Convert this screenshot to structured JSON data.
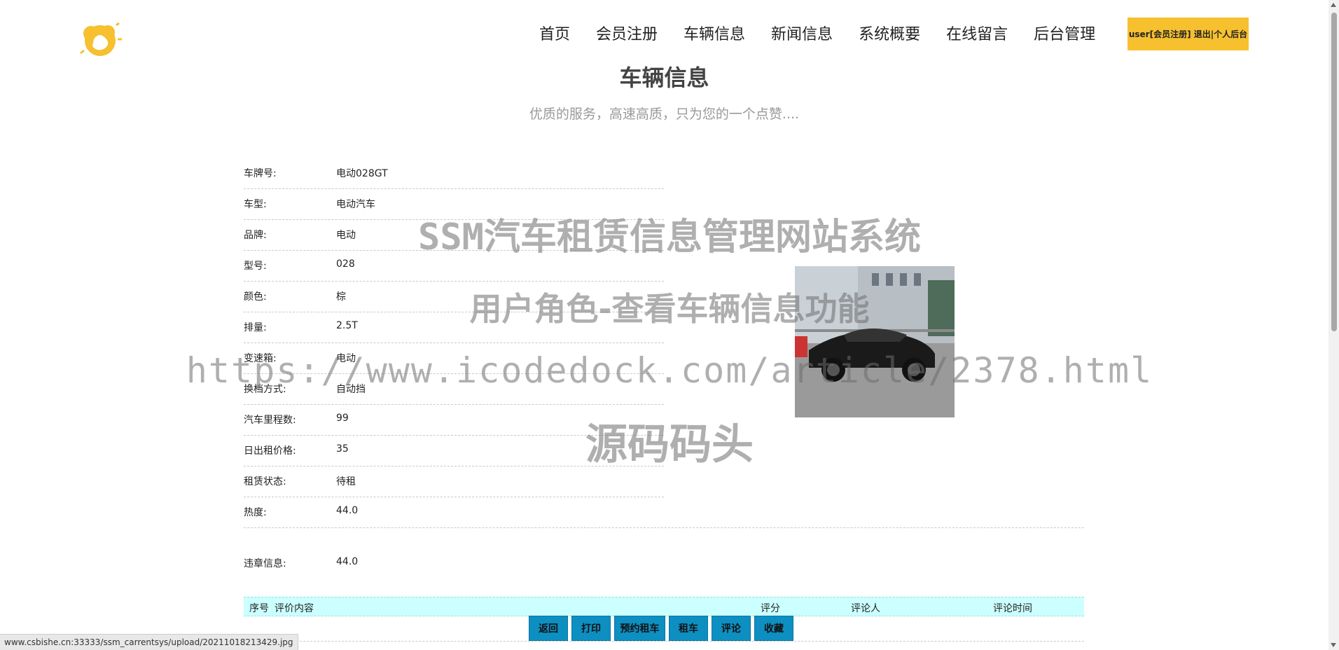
{
  "header": {
    "logo_icon": "sun-cloud-logo-icon",
    "nav": [
      "首页",
      "会员注册",
      "车辆信息",
      "新闻信息",
      "系统概要",
      "在线留言",
      "后台管理"
    ],
    "user_box": "user[会员注册] 退出|个人后台"
  },
  "page": {
    "title": "车辆信息",
    "subtitle": "优质的服务，高速高质，只为您的一个点赞...."
  },
  "details": [
    {
      "label": "车牌号:",
      "value": "电动028GT"
    },
    {
      "label": "车型:",
      "value": "电动汽车"
    },
    {
      "label": "品牌:",
      "value": "电动"
    },
    {
      "label": "型号:",
      "value": "028"
    },
    {
      "label": "颜色:",
      "value": "棕"
    },
    {
      "label": "排量:",
      "value": "2.5T"
    },
    {
      "label": "变速箱:",
      "value": "电动"
    },
    {
      "label": "换档方式:",
      "value": "自动挡"
    },
    {
      "label": "汽车里程数:",
      "value": "99"
    },
    {
      "label": "日出租价格:",
      "value": "35"
    },
    {
      "label": "租赁状态:",
      "value": "待租"
    },
    {
      "label": "热度:",
      "value": "44.0"
    }
  ],
  "violation": {
    "label": "违章信息:",
    "value": "44.0"
  },
  "car_image": {
    "icon": "car-photo",
    "colors": {
      "car": "#1a1a1a",
      "building": "#c9d0d6",
      "ground": "#9a9a9a"
    }
  },
  "comments": {
    "headers": [
      "序号",
      "评价内容",
      "评分",
      "评论人",
      "评论时间"
    ]
  },
  "buttons": [
    "返回",
    "打印",
    "预约租车",
    "租车",
    "评论",
    "收藏"
  ],
  "watermark": {
    "line1": "SSM汽车租赁信息管理网站系统",
    "line2": "用户角色-查看车辆信息功能",
    "line3": "https://www.icodedock.com/article/2378.html",
    "line4": "源码码头"
  },
  "status_url": "www.csbishe.cn:33333/ssm_carrentsys/upload/20211018213429.jpg",
  "colors": {
    "accent": "#f6c02f",
    "button": "#0e8fc2",
    "table_header": "#ccffff"
  }
}
